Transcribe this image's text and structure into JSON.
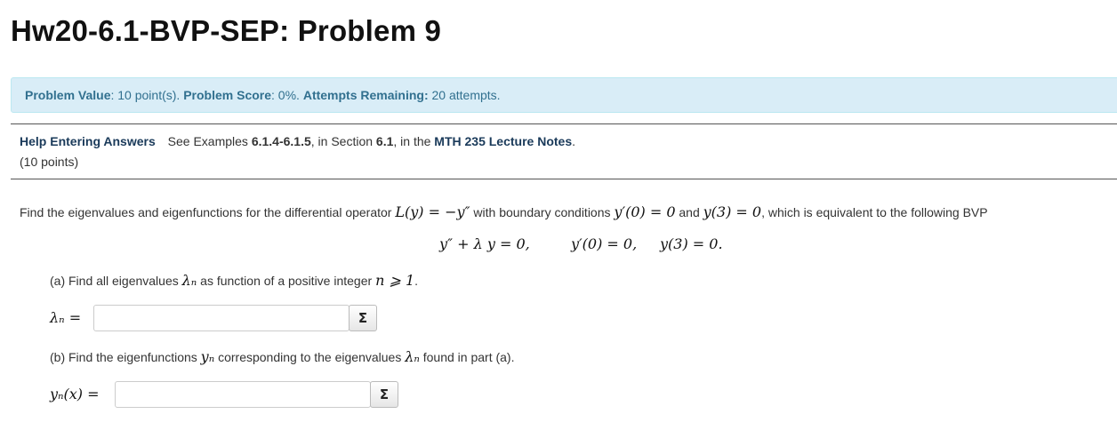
{
  "page": {
    "title": "Hw20-6.1-BVP-SEP: Problem 9"
  },
  "info_bar": {
    "value_label": "Problem Value",
    "value_text": ": 10 point(s).",
    "score_label": "Problem Score",
    "score_text": ": 0%.",
    "attempts_label": "Attempts Remaining:",
    "attempts_text": "20 attempts."
  },
  "help": {
    "link_label": "Help Entering Answers",
    "see_text": "See Examples",
    "examples": "6.1.4-6.1.5",
    "in_section_text": ", in Section",
    "section": "6.1",
    "in_the_text": ", in the",
    "notes": "MTH 235 Lecture Notes",
    "period": "."
  },
  "points_text": "(10 points)",
  "question": {
    "prefix": "Find the eigenvalues and eigenfunctions for the differential operator",
    "operator_eq": "L(y) = −y″",
    "middle": "with boundary conditions",
    "bc1": "y′(0) = 0",
    "and_text": "and",
    "bc2": "y(3) = 0",
    "suffix": ", which is equivalent to the following BVP"
  },
  "display": {
    "ode": "y″ + λ y = 0,",
    "bc1": "y′(0) = 0,",
    "bc2": "y(3) = 0."
  },
  "part_a": {
    "text_before": "(a) Find all eigenvalues",
    "symbol": "λₙ",
    "text_after": "as function of a positive integer",
    "condition": "n ⩾ 1",
    "end": ".",
    "answer_label": "λₙ =",
    "answer_value": "",
    "equation_button": "Σ"
  },
  "part_b": {
    "text_before": "(b) Find the eigenfunctions",
    "symbol": "yₙ",
    "text_middle": "corresponding to the eigenvalues",
    "symbol2": "λₙ",
    "text_after": "found in part (a).",
    "answer_label": "yₙ(x) =",
    "answer_value": "",
    "equation_button": "Σ"
  }
}
